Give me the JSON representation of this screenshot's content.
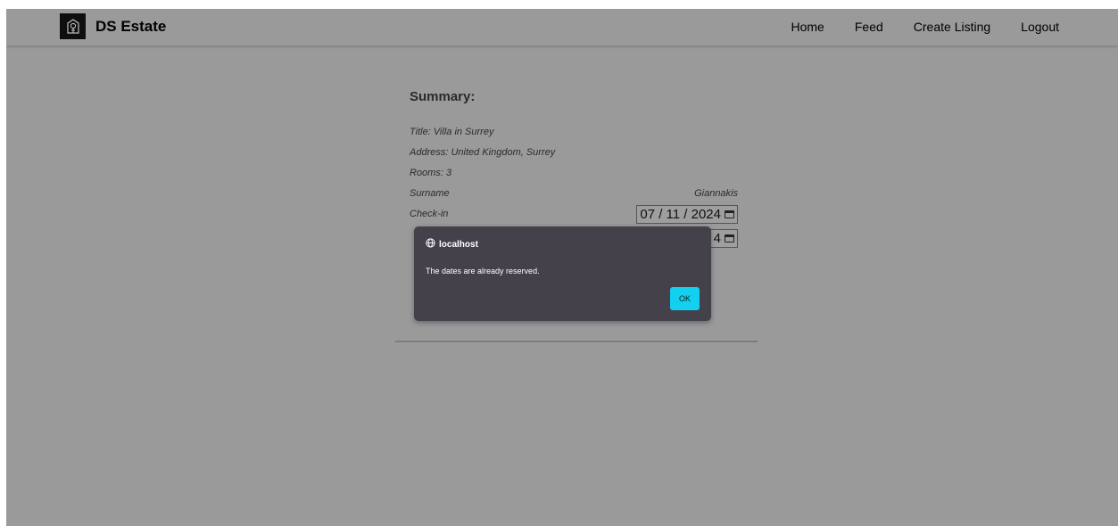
{
  "navbar": {
    "brand": "DS Estate",
    "links": [
      "Home",
      "Feed",
      "Create Listing",
      "Logout"
    ]
  },
  "summary": {
    "heading": "Summary:",
    "title_line": "Title: Villa in Surrey",
    "address_line": "Address: United Kingdom, Surrey",
    "rooms_line": "Rooms: 3",
    "surname_label": "Surname",
    "surname_value": "Giannakis",
    "checkin_label": "Check-in",
    "checkin_value": "07 / 11 / 2024",
    "checkout_value_visible": "4"
  },
  "dialog": {
    "origin": "localhost",
    "message": "The dates are already reserved.",
    "ok_label": "OK"
  },
  "colors": {
    "overlay_bg": "#9a9a9b",
    "dialog_bg": "#45414b",
    "ok_button": "#14d0f0"
  },
  "icons": [
    "estate-logo-icon",
    "globe-icon",
    "calendar-icon"
  ]
}
